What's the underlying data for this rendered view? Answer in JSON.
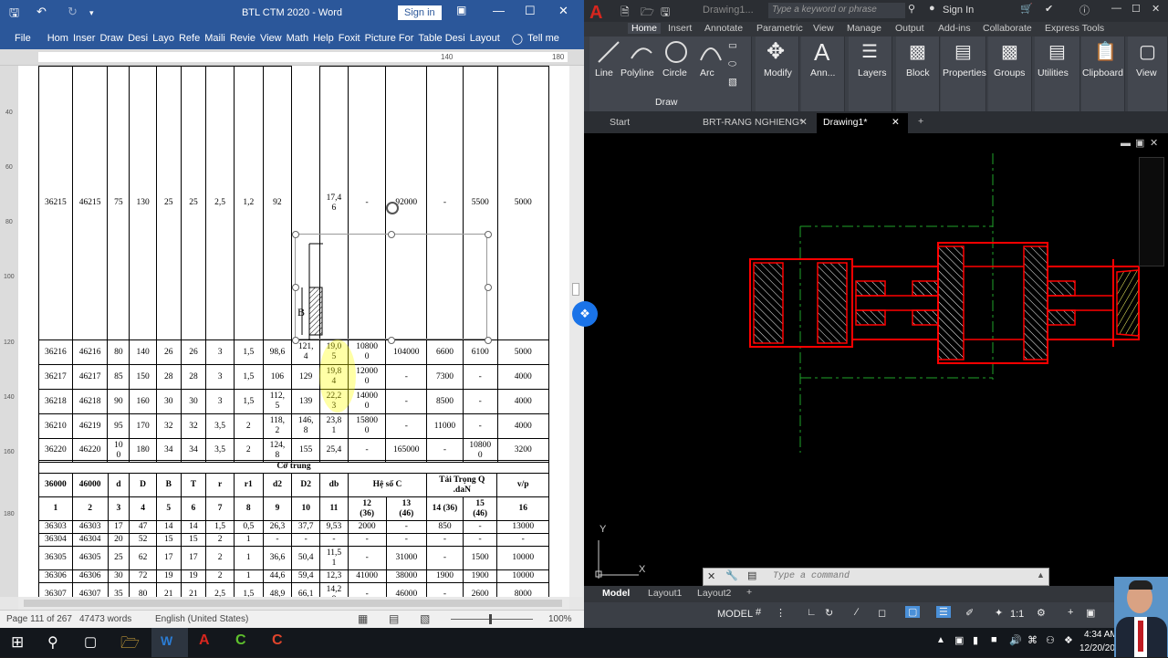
{
  "word": {
    "title": "BTL CTM 2020  -  Word",
    "sign_in": "Sign in",
    "tabs": [
      "File",
      "Hom",
      "Inser",
      "Draw",
      "Desi",
      "Layo",
      "Refe",
      "Maili",
      "Revie",
      "View",
      "Math",
      "Help",
      "Foxit",
      "Picture For",
      "Table Desi",
      "Layout"
    ],
    "tell_me": "Tell me",
    "ruler_marks": [
      "40",
      "60",
      "80",
      "100",
      "120",
      "140",
      "160",
      "180"
    ],
    "shape_label": "B",
    "rows_top": [
      [
        "36215",
        "46215",
        "75",
        "130",
        "25",
        "25",
        "2,5",
        "1,2",
        "92",
        "",
        "17,4\n6",
        "-",
        "92000",
        "-",
        "5500",
        "5000"
      ],
      [
        "36216",
        "46216",
        "80",
        "140",
        "26",
        "26",
        "3",
        "1,5",
        "98,6",
        "121,\n4",
        "19,0\n5",
        "10800\n0",
        "104000",
        "6600",
        "6100",
        "5000"
      ],
      [
        "36217",
        "46217",
        "85",
        "150",
        "28",
        "28",
        "3",
        "1,5",
        "106",
        "129",
        "19,8\n4",
        "12000\n0",
        "-",
        "7300",
        "-",
        "4000"
      ],
      [
        "36218",
        "46218",
        "90",
        "160",
        "30",
        "30",
        "3",
        "1,5",
        "112,\n5",
        "139",
        "22,2\n3",
        "14000\n0",
        "-",
        "8500",
        "-",
        "4000"
      ],
      [
        "36210",
        "46219",
        "95",
        "170",
        "32",
        "32",
        "3,5",
        "2",
        "118,\n2",
        "146,\n8",
        "23,8\n1",
        "15800\n0",
        "-",
        "11000",
        "-",
        "4000"
      ],
      [
        "36220",
        "46220",
        "10\n0",
        "180",
        "34",
        "34",
        "3,5",
        "2",
        "124,\n8",
        "155",
        "25,4",
        "-",
        "165000",
        "-",
        "10800\n0",
        "3200"
      ]
    ],
    "section_title": "Cỡ  trung",
    "header_row": [
      "36000",
      "46000",
      "d",
      "D",
      "B",
      "T",
      "r",
      "r1",
      "d2",
      "D2",
      "db",
      "Hệ số C",
      "Tải  Trọng  Q\n.daN",
      "v/p"
    ],
    "number_row": [
      "1",
      "2",
      "3",
      "4",
      "5",
      "6",
      "7",
      "8",
      "9",
      "10",
      "11",
      "12\n(36)",
      "13\n(46)",
      "14 (36)",
      "15\n(46)",
      "16"
    ],
    "rows_bottom": [
      [
        "36303",
        "46303",
        "17",
        "47",
        "14",
        "14",
        "1,5",
        "0,5",
        "26,3",
        "37,7",
        "9,53",
        "2000",
        "-",
        "850",
        "-",
        "13000"
      ],
      [
        "36304",
        "46304",
        "20",
        "52",
        "15",
        "15",
        "2",
        "1",
        "-",
        "-",
        "-",
        "-",
        "-",
        "-",
        "-",
        "-"
      ],
      [
        "36305",
        "46305",
        "25",
        "62",
        "17",
        "17",
        "2",
        "1",
        "36,6",
        "50,4",
        "11,5\n1",
        "-",
        "31000",
        "-",
        "1500",
        "10000"
      ],
      [
        "36306",
        "46306",
        "30",
        "72",
        "19",
        "19",
        "2",
        "1",
        "44,6",
        "59,4",
        "12,3",
        "41000",
        "38000",
        "1900",
        "1900",
        "10000"
      ],
      [
        "36307",
        "46307",
        "35",
        "80",
        "21",
        "21",
        "2,5",
        "1,5",
        "48,9",
        "66,1",
        "14,2\n8",
        "-",
        "46000",
        "-",
        "2600",
        "8000"
      ]
    ],
    "status": {
      "page": "Page 111 of 267",
      "words": "47473 words",
      "lang": "English (United States)",
      "zoom": "100%"
    }
  },
  "acad": {
    "title": "Drawing1...",
    "search_placeholder": "Type a keyword or phrase",
    "sign_in": "Sign In",
    "ribbon_tabs": [
      "Home",
      "Insert",
      "Annotate",
      "Parametric",
      "View",
      "Manage",
      "Output",
      "Add-ins",
      "Collaborate",
      "Express Tools"
    ],
    "draw_tools": [
      "Line",
      "Polyline",
      "Circle",
      "Arc"
    ],
    "draw_panel": "Draw",
    "groups": [
      "Modify",
      "Ann...",
      "Layers",
      "Block",
      "Properties",
      "Groups",
      "Utilities",
      "Clipboard",
      "View"
    ],
    "file_tabs": [
      "Start",
      "BRT-RANG NGHIENG*",
      "Drawing1*"
    ],
    "command_placeholder": "Type  a  command",
    "layout_tabs": [
      "Model",
      "Layout1",
      "Layout2"
    ],
    "status_model": "MODEL",
    "scale": "1:1",
    "ucs_x": "X",
    "ucs_y": "Y",
    "colors": {
      "part": "#ff0000",
      "center": "#1fa32a",
      "hatch": "#ffff66"
    }
  },
  "taskbar": {
    "time": "4:34 AM",
    "date": "12/20/20"
  }
}
